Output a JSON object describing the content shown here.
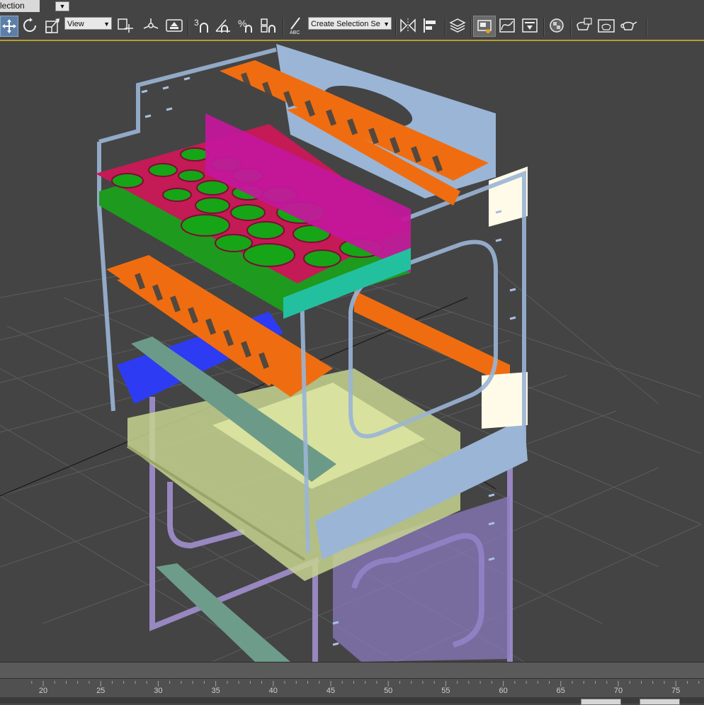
{
  "selection_tab": {
    "label": "lection"
  },
  "toolbar": {
    "view_dropdown": "View",
    "named_selection_dropdown": "Create Selection Se",
    "snap_label": "3"
  },
  "icons": {
    "select_move": "move-icon",
    "rotate": "rotate-icon",
    "scale": "scale-icon",
    "pivot": "pivot-icon",
    "select_manipulate": "manipulate-icon",
    "snap_3d": "snap-toggle-icon",
    "angle_snap": "angle-snap-icon",
    "percent_snap": "percent-snap-icon",
    "spinner_snap": "spinner-snap-icon",
    "edit_named": "edit-named-selection-icon",
    "mirror": "mirror-icon",
    "align": "align-icon",
    "layer_manager": "layer-manager-icon",
    "scene_explorer": "scene-explorer-icon",
    "curve_editor": "curve-editor-icon",
    "schematic_view": "schematic-view-icon",
    "material_editor": "material-editor-icon",
    "render_setup": "render-setup-icon",
    "rendered_frame": "rendered-frame-window-icon",
    "render": "render-teapot-icon"
  },
  "timeline": {
    "ticks": [
      "20",
      "25",
      "30",
      "35",
      "40",
      "45",
      "50",
      "55",
      "60",
      "65",
      "70",
      "75"
    ]
  },
  "colors": {
    "toolbar_bg": "#444444",
    "accent_line": "#b79e2c",
    "active_button": "#5d7fa7",
    "viewport_bg": "#444444",
    "grid": "#5c5c5c"
  }
}
